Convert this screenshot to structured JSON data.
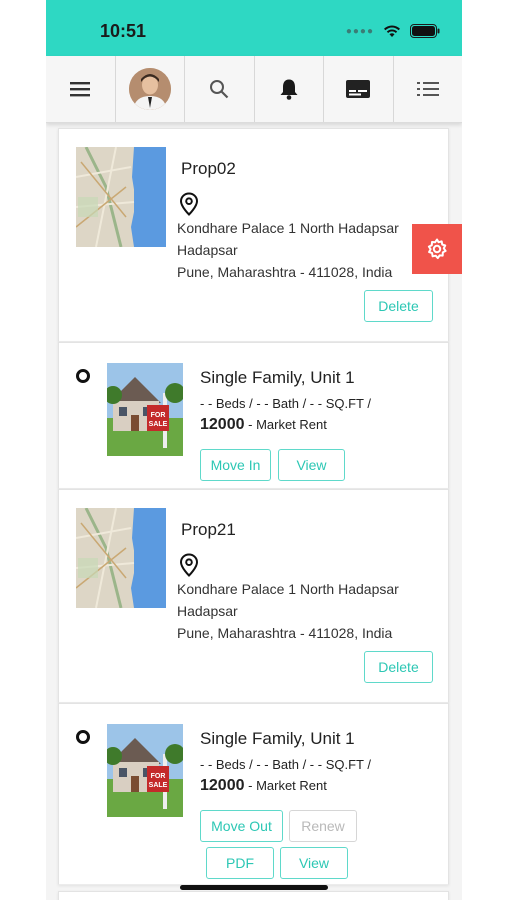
{
  "status": {
    "time": "10:51"
  },
  "toolbar": {
    "items": [
      {
        "icon": "menu-icon"
      },
      {
        "icon": "avatar"
      },
      {
        "icon": "search-icon"
      },
      {
        "icon": "bell-icon"
      },
      {
        "icon": "card-icon"
      },
      {
        "icon": "list-icon"
      }
    ]
  },
  "properties": [
    {
      "name": "Prop02",
      "address_line1": "Kondhare Palace 1 North Hadapsar",
      "address_line2": "Hadapsar",
      "address_line3": "Pune, Maharashtra - 411028, India",
      "delete_label": "Delete",
      "unit": {
        "title": "Single Family, Unit 1",
        "specs": "- - Beds / - - Bath / - - SQ.FT /",
        "rent_value": "12000",
        "rent_label": "- Market Rent",
        "btn_move": "Move In",
        "btn_view": "View"
      }
    },
    {
      "name": "Prop21",
      "address_line1": "Kondhare Palace 1 North Hadapsar",
      "address_line2": "Hadapsar",
      "address_line3": "Pune, Maharashtra - 411028, India",
      "delete_label": "Delete",
      "unit": {
        "title": "Single Family, Unit 1",
        "specs": "- - Beds / - - Bath / - - SQ.FT /",
        "rent_value": "12000",
        "rent_label": "- Market Rent",
        "btn_move": "Move Out",
        "btn_renew": "Renew",
        "btn_pdf": "PDF",
        "btn_view": "View"
      }
    }
  ],
  "sign": {
    "text": "FOR SALE"
  },
  "colors": {
    "accent": "#2ed8c3",
    "button_border": "#5fd9ca",
    "gear_tab": "#f0534a"
  }
}
